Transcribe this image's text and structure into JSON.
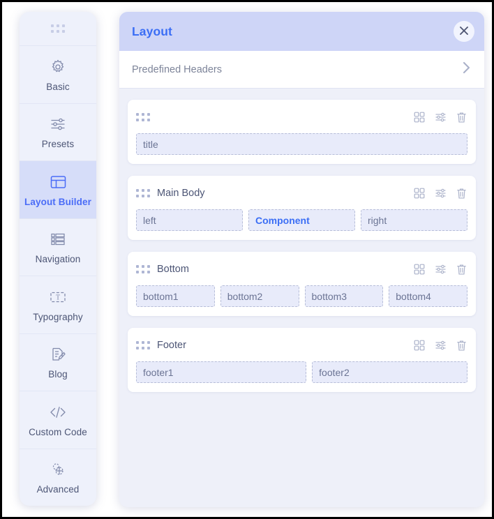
{
  "sidebar": {
    "handle_icon": "drag-dots-icon",
    "items": [
      {
        "label": "Basic",
        "icon": "gear-icon",
        "active": false
      },
      {
        "label": "Presets",
        "icon": "sliders-icon",
        "active": false
      },
      {
        "label": "Layout Builder",
        "icon": "layout-icon",
        "active": true
      },
      {
        "label": "Navigation",
        "icon": "list-icon",
        "active": false
      },
      {
        "label": "Typography",
        "icon": "text-box-icon",
        "active": false
      },
      {
        "label": "Blog",
        "icon": "edit-doc-icon",
        "active": false
      },
      {
        "label": "Custom Code",
        "icon": "code-icon",
        "active": false
      },
      {
        "label": "Advanced",
        "icon": "advanced-icon",
        "active": false
      }
    ]
  },
  "panel": {
    "title": "Layout",
    "close_label": "×",
    "predefined": {
      "label": "Predefined Headers",
      "chevron_icon": "chevron-right-icon"
    },
    "actions": {
      "columns_icon": "grid-columns-icon",
      "settings_icon": "sliders-settings-icon",
      "delete_icon": "trash-icon"
    },
    "rows": [
      {
        "name": "",
        "slots": [
          {
            "text": "title",
            "accent": false
          }
        ]
      },
      {
        "name": "Main Body",
        "slots": [
          {
            "text": "left",
            "accent": false
          },
          {
            "text": "Component",
            "accent": true
          },
          {
            "text": "right",
            "accent": false
          }
        ]
      },
      {
        "name": "Bottom",
        "slots": [
          {
            "text": "bottom1",
            "accent": false
          },
          {
            "text": "bottom2",
            "accent": false
          },
          {
            "text": "bottom3",
            "accent": false
          },
          {
            "text": "bottom4",
            "accent": false
          }
        ]
      },
      {
        "name": "Footer",
        "slots": [
          {
            "text": "footer1",
            "accent": false
          },
          {
            "text": "footer2",
            "accent": false
          }
        ]
      }
    ]
  },
  "colors": {
    "accent_blue": "#3b6ef5",
    "header_bar": "#ced5f7",
    "panel_bg": "#eef0f9",
    "sidebar_bg": "#eef1fb",
    "sidebar_active_bg": "#d6ddf9",
    "slot_bg": "#e8ebfa",
    "slot_border": "#b6bdd8",
    "muted_text": "#6b7494"
  }
}
